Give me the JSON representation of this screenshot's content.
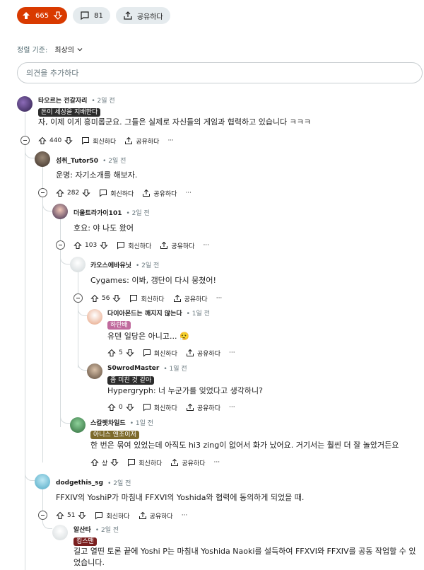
{
  "topbar": {
    "votes": "665",
    "comments": "81",
    "share": "공유하다"
  },
  "sort": {
    "label": "정렬 기준:",
    "value": "최상의"
  },
  "add_comment": {
    "placeholder": "의견을 추가하다"
  },
  "labels": {
    "reply": "회신하다",
    "share": "공유하다",
    "more": "···"
  },
  "comments": [
    {
      "user": "타오르는 전갈자리",
      "time": "• 2일 전",
      "flair": "돈이 세상을 지배한다",
      "body": "자, 이제 이게 흥미롭군요. 그들은 실제로 자신들의 게임과 협력하고 있습니다 ㅋㅋㅋ",
      "score": "440"
    },
    {
      "user": "성취_Tutor50",
      "time": "• 2일 전",
      "flair": "",
      "body": "운명: 자기소개를 해보자.",
      "score": "282"
    },
    {
      "user": "더울트라가이101",
      "time": "• 2일 전",
      "flair": "",
      "body": "호요: 야 나도 왔어",
      "score": "103"
    },
    {
      "user": "카오스에바유닛",
      "time": "• 2일 전",
      "flair": "",
      "body": "Cygames: 이봐, 갱단이 다시 뭉쳤어!",
      "score": "56"
    },
    {
      "user": "다이아몬드는 깨지지 않는다",
      "time": "• 1일 전",
      "flair": "하란배",
      "body": "유덴 일당은 아니고... 😮‍💨",
      "score": "5"
    },
    {
      "user": "S0wrodMaster",
      "time": "• 1일 전",
      "flair": "좀 미친 것 같아",
      "body": "Hypergryph: 너 누군가를 잊었다고 생각하니?",
      "score": "0"
    },
    {
      "user": "스칼렛차일드",
      "time": "• 1일 전",
      "flair": "아니스 앤조이저",
      "body": "한 번은 묶여 있었는데 아직도 hi3 zing이 없어서 화가 났어요. 거기서는 훨씬 더 잘 놀았거든요",
      "score": "상"
    },
    {
      "user": "dodgethis_sg",
      "time": "• 2일 전",
      "flair": "",
      "body": "FFXIV의 YoshiP가 마침내 FFXVI의 Yoshida와 협력에 동의하게 되었을 때.",
      "score": "51"
    },
    {
      "user": "알산타",
      "time": "• 2일 전",
      "flair": "킹스맨",
      "body": "길고 열띤 토론 끝에 Yoshi P는 마침내 Yoshida Naoki를 설득하여 FFXVI와 FFXIV를 공동 작업할 수 있었습니다.",
      "score": ""
    }
  ]
}
